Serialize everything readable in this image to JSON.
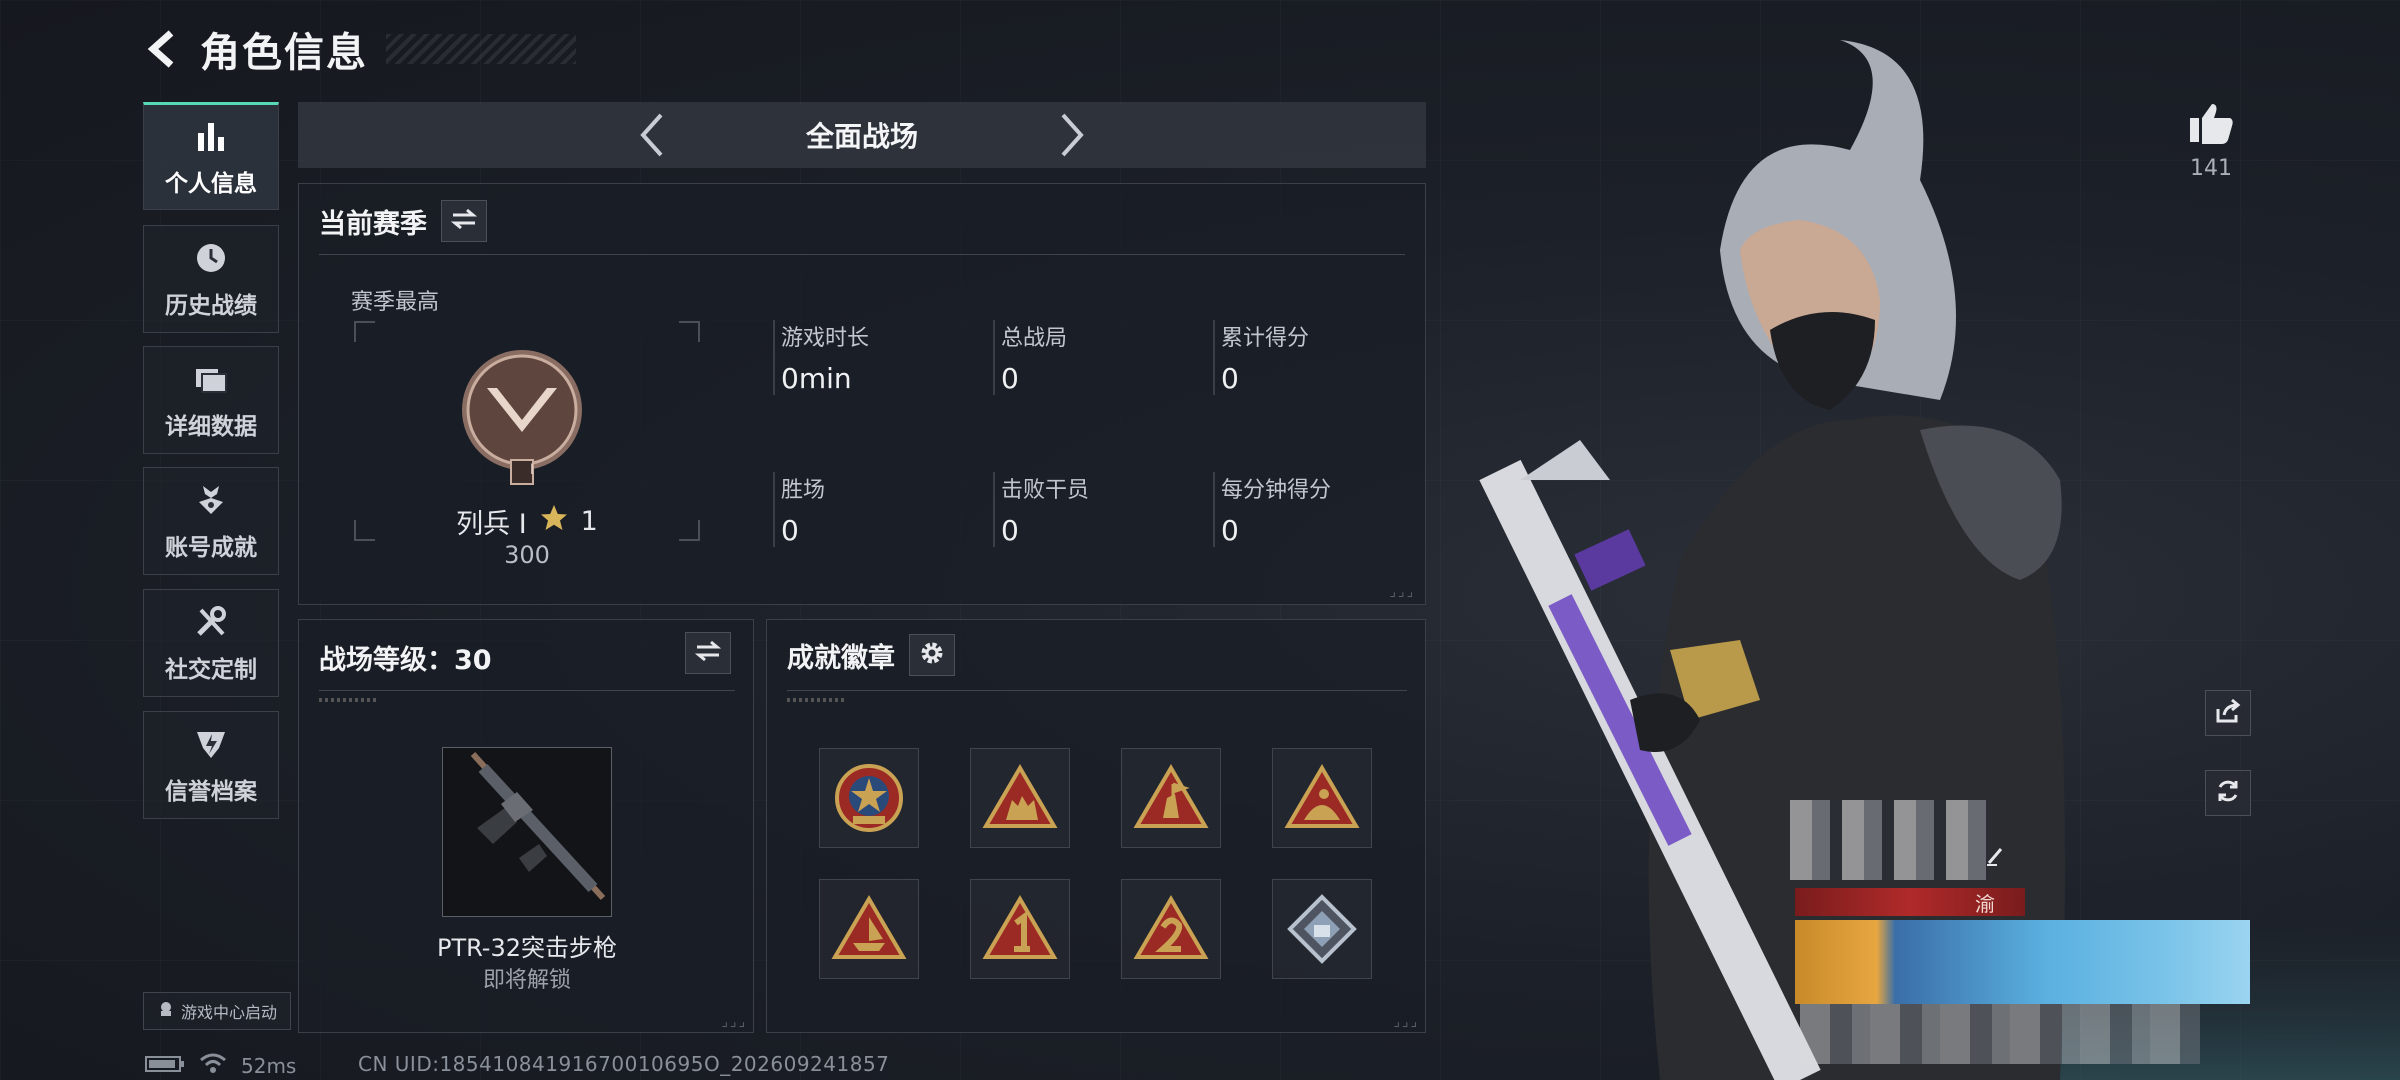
{
  "header": {
    "title": "角色信息"
  },
  "sidebar": {
    "items": [
      {
        "label": "个人信息",
        "icon": "bar-chart-icon",
        "active": true
      },
      {
        "label": "历史战绩",
        "icon": "clock-icon"
      },
      {
        "label": "详细数据",
        "icon": "folders-icon"
      },
      {
        "label": "账号成就",
        "icon": "achievement-icon"
      },
      {
        "label": "社交定制",
        "icon": "tools-icon"
      },
      {
        "label": "信誉档案",
        "icon": "shield-lightning-icon"
      }
    ],
    "launch_label": "游戏中心启动"
  },
  "mode": {
    "label": "全面战场"
  },
  "season": {
    "title": "当前赛季",
    "best_label": "赛季最高",
    "rank_name": "列兵 Ⅰ",
    "rank_stars": "1",
    "rank_points": "300",
    "rank_badge_numeral": "Ⅰ",
    "stats": [
      {
        "label": "游戏时长",
        "value": "0min"
      },
      {
        "label": "总战局",
        "value": "0"
      },
      {
        "label": "累计得分",
        "value": "0"
      },
      {
        "label": "胜场",
        "value": "0"
      },
      {
        "label": "击败干员",
        "value": "0"
      },
      {
        "label": "每分钟得分",
        "value": "0"
      }
    ]
  },
  "battlefield_level": {
    "title": "战场等级：30",
    "weapon_name": "PTR-32突击步枪",
    "weapon_status": "即将解锁"
  },
  "achievements": {
    "title": "成就徽章",
    "badges": [
      "badge-star-shield",
      "badge-soldiers",
      "badge-soldier-flag",
      "badge-rider",
      "badge-ship",
      "badge-number-1",
      "badge-number-2",
      "badge-diamond"
    ]
  },
  "profile": {
    "likes": "141",
    "name_fragment": "渝"
  },
  "status": {
    "ping": "52ms",
    "uid": "CN UID:18541084191670010695O_202609241857"
  },
  "colors": {
    "accent": "#56d9b4",
    "gold": "#c9a253",
    "badge_red": "#9c2a24"
  }
}
